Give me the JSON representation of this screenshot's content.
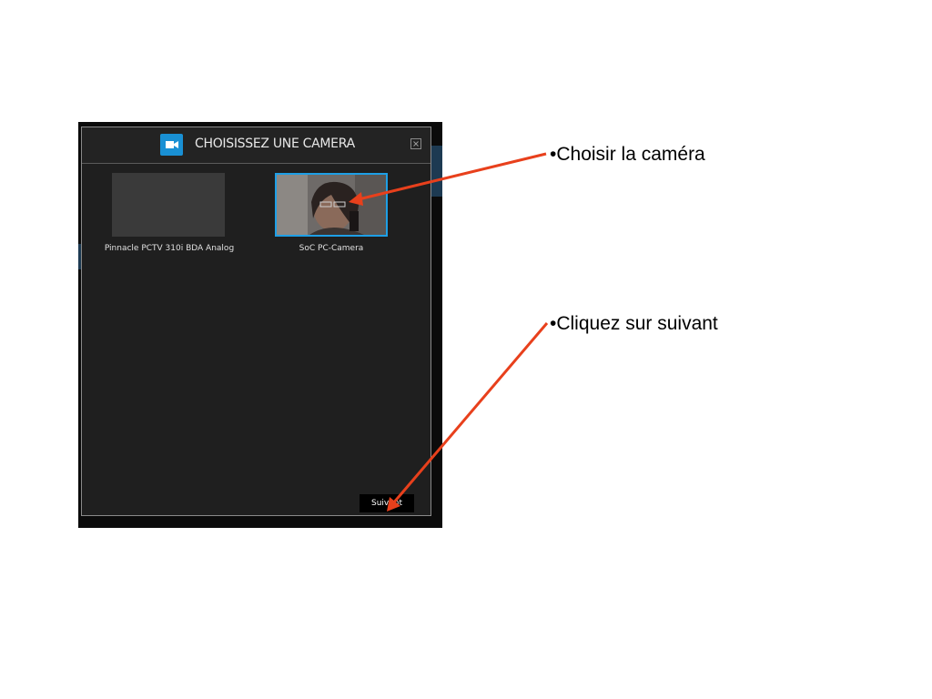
{
  "dialog": {
    "title": "CHOISISSEZ UNE CAMERA",
    "header_icon": "video-camera-icon",
    "close_icon": "close-icon",
    "next_label": "Suivant"
  },
  "cameras": [
    {
      "label": "Pinnacle PCTV 310i BDA Analog",
      "selected": false
    },
    {
      "label": "SoC PC-Camera",
      "selected": true
    }
  ],
  "annotations": [
    {
      "text": "•Choisir la caméra"
    },
    {
      "text": "•Cliquez sur suivant"
    }
  ],
  "colors": {
    "accent": "#1e9fe6",
    "arrow": "#e8401c",
    "dialog_bg": "#1f1f1f"
  }
}
